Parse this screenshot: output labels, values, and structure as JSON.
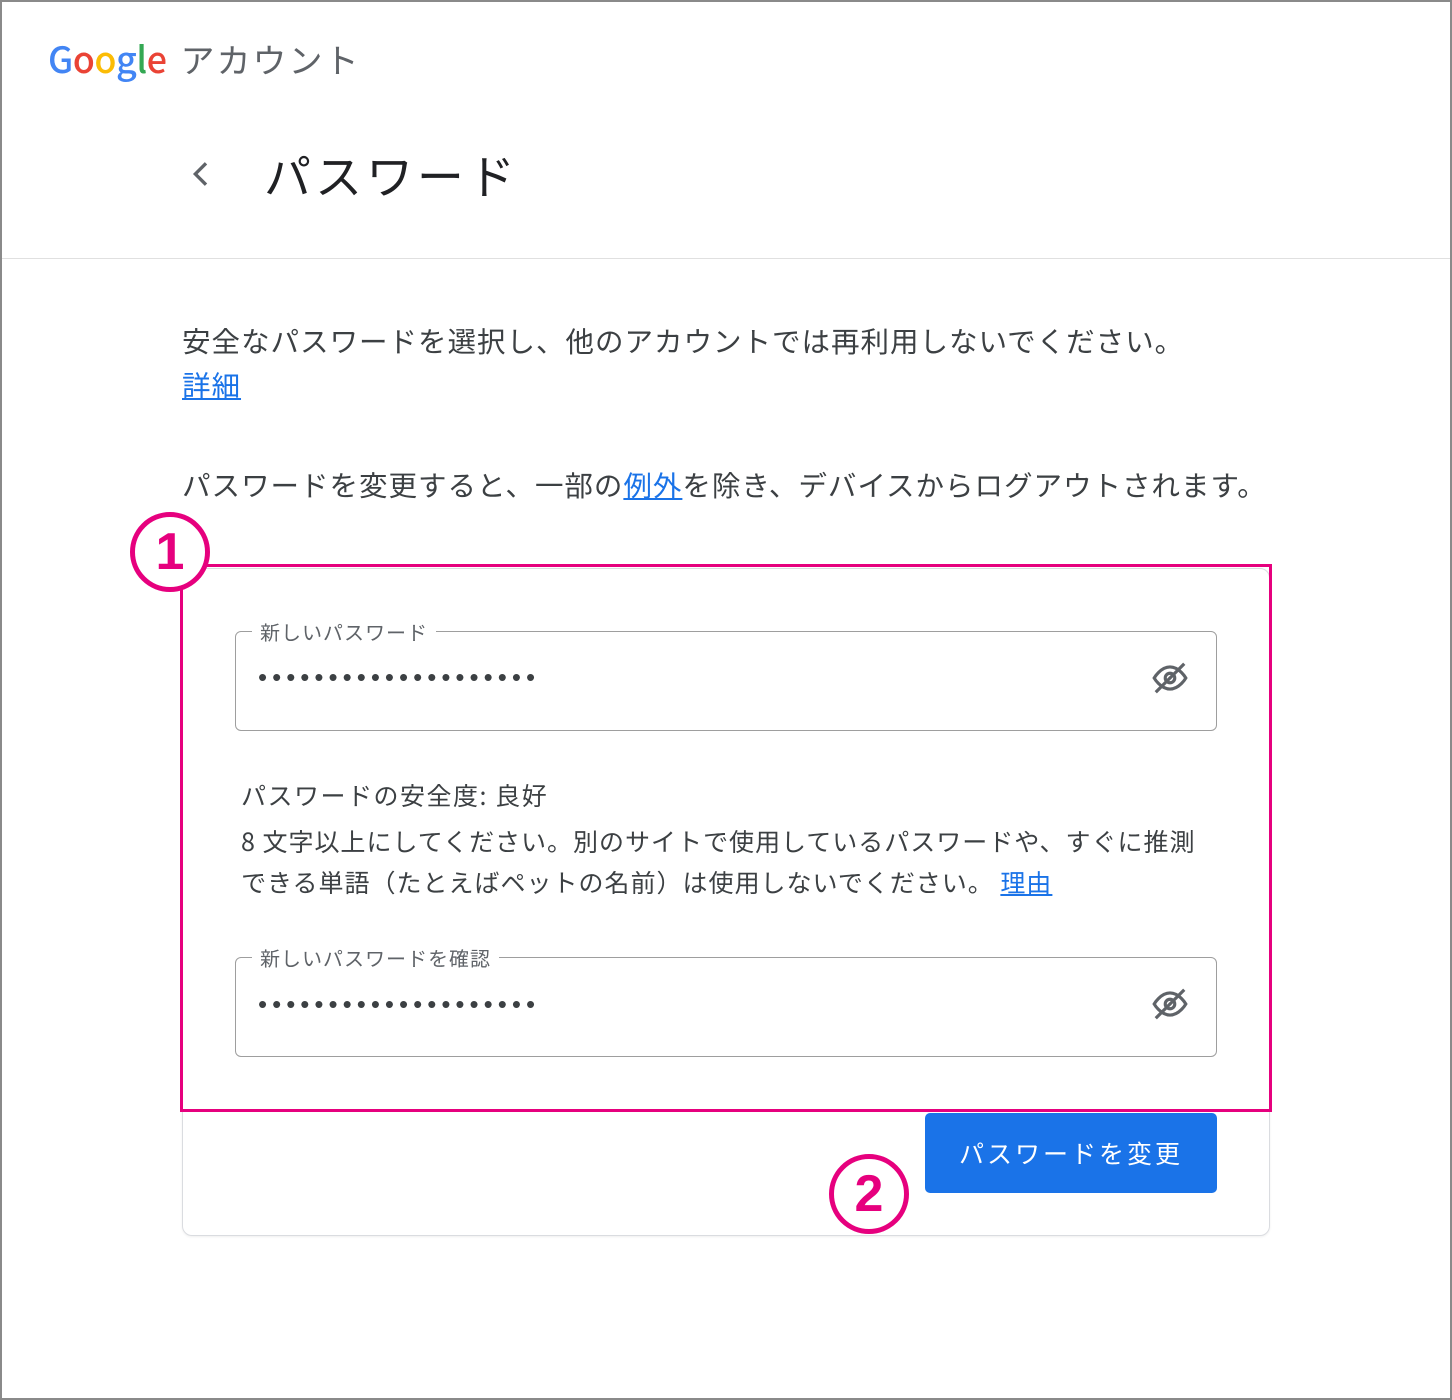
{
  "brand": {
    "g1": "G",
    "g2": "o",
    "g3": "o",
    "g4": "g",
    "g5": "l",
    "g6": "e",
    "account_label": "アカウント"
  },
  "header": {
    "title": "パスワード"
  },
  "intro": {
    "text": "安全なパスワードを選択し、他のアカウントでは再利用しないでください。",
    "details_link": "詳細",
    "logout_pre": "パスワードを変更すると、一部の",
    "logout_link": "例外",
    "logout_post": "を除き、デバイスからログアウトされます。"
  },
  "form": {
    "new_password_label": "新しいパスワード",
    "new_password_value": "••••••••••••••••••••",
    "confirm_label": "新しいパスワードを確認",
    "confirm_value": "••••••••••••••••••••",
    "strength_label": "パスワードの安全度:",
    "strength_value": "良好",
    "hint_text": "8 文字以上にしてください。別のサイトで使用しているパスワードや、すぐに推測できる単語（たとえばペットの名前）は使用しないでください。",
    "hint_link": "理由",
    "submit_label": "パスワードを変更"
  },
  "annotations": {
    "callout1": "1",
    "callout2": "2"
  }
}
